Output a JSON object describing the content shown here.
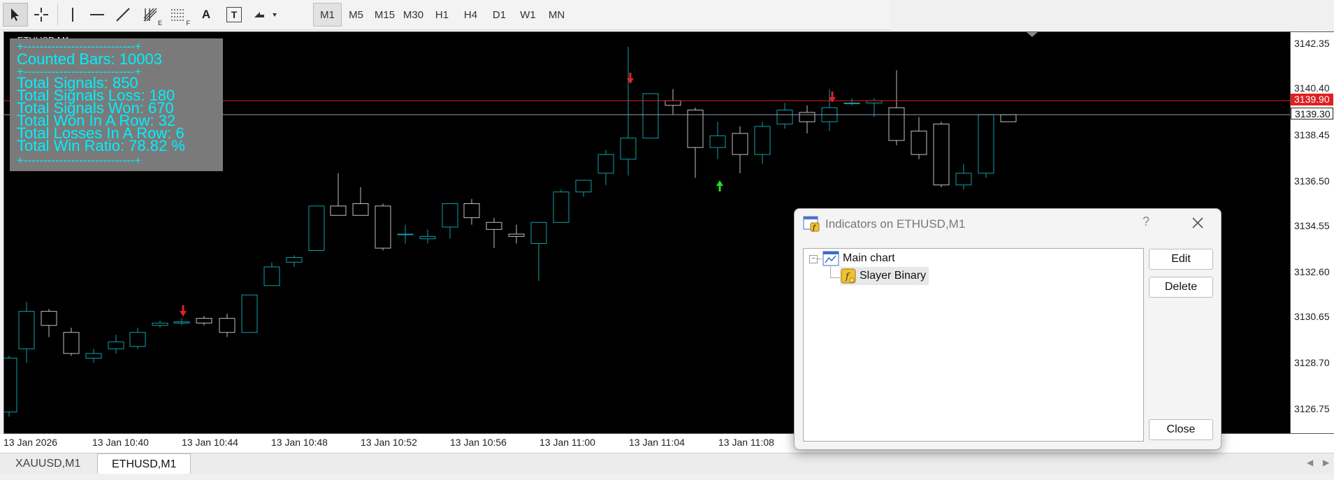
{
  "toolbar": {
    "tools": [
      "cursor-icon",
      "crosshair-icon",
      "vertical-line-icon",
      "horizontal-line-icon",
      "trendline-icon",
      "fibonacci-icon",
      "gann-icon",
      "text-icon",
      "text-label-icon",
      "arrows-icon"
    ],
    "tool_letters": {
      "fib": "E",
      "gann": "F",
      "text": "A",
      "label": "T"
    },
    "timeframes": [
      "M1",
      "M5",
      "M15",
      "M30",
      "H1",
      "H4",
      "D1",
      "W1",
      "MN"
    ],
    "active_timeframe": "M1"
  },
  "chart": {
    "symbol_label": "ETHUSD,M1",
    "stats": {
      "separator": "+----------------------------+",
      "counted_bars": "Counted Bars: 10003",
      "total_signals": "Total Signals: 850",
      "signals_loss": "Total Signals Loss: 180",
      "signals_won": "Total Signals Won: 670",
      "won_in_row": "Total Won In A Row: 32",
      "losses_in_row": "Total Losses In A Row: 6",
      "win_ratio": "Total Win Ratio: 78.82 %"
    },
    "price_labels": [
      "3142.35",
      "3140.40",
      "3138.45",
      "3136.50",
      "3134.55",
      "3132.60",
      "3130.65",
      "3128.70",
      "3126.75"
    ],
    "bid_price": "3139.90",
    "ask_price": "3139.30",
    "time_labels": [
      "13 Jan 2026",
      "13 Jan 10:40",
      "13 Jan 10:44",
      "13 Jan 10:48",
      "13 Jan 10:52",
      "13 Jan 10:56",
      "13 Jan 11:00",
      "13 Jan 11:04",
      "13 Jan 11:08"
    ],
    "colors": {
      "background": "#000000",
      "candle_up": "#0fa0a8",
      "candle_down": "#c0c0c0",
      "sell_arrow": "#e0202a",
      "buy_arrow": "#22dd22",
      "bid_line": "#e02020",
      "ask_line": "#8aa0b8",
      "stats_text": "#00f0ff"
    }
  },
  "tabs": [
    {
      "label": "XAUUSD,M1",
      "active": false
    },
    {
      "label": "ETHUSD,M1",
      "active": true
    }
  ],
  "dialog": {
    "title": "Indicators on ETHUSD,M1",
    "help": "?",
    "tree": {
      "root": "Main chart",
      "child": "Slayer Binary"
    },
    "buttons": {
      "edit": "Edit",
      "delete": "Delete",
      "close": "Close"
    }
  }
}
